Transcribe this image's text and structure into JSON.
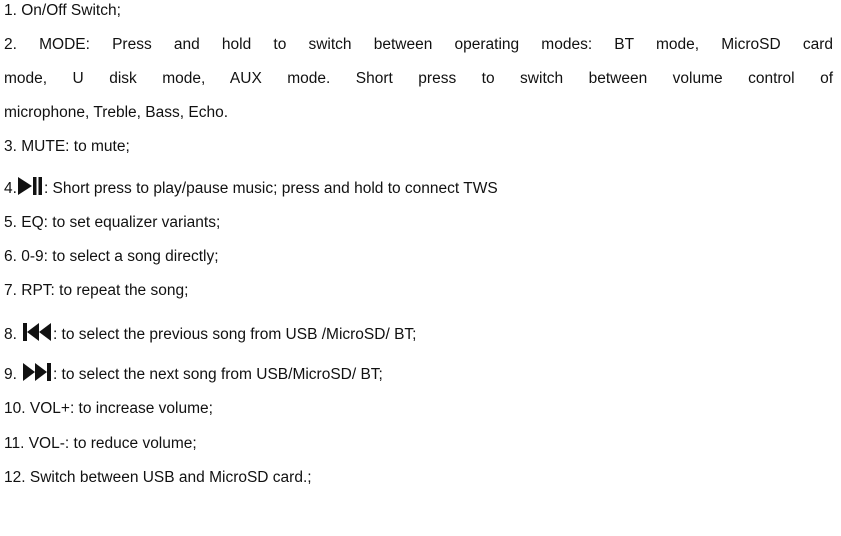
{
  "items": [
    {
      "number": "1.",
      "text": "On/Off Switch;"
    },
    {
      "number": "2.",
      "text": "MODE: Press and hold to switch between operating modes: BT mode, MicroSD card",
      "text_line2": "mode, U disk mode, AUX mode. Short press to switch between volume control of",
      "text_line3": "microphone, Treble, Bass, Echo."
    },
    {
      "number": "3.",
      "text": "MUTE: to mute;"
    },
    {
      "number": "4.",
      "icon": "play-pause-icon",
      "text": ": Short press to play/pause music; press and hold to connect TWS"
    },
    {
      "number": "5.",
      "text": "EQ: to set equalizer variants;"
    },
    {
      "number": "6.",
      "text": "0-9: to select a song directly;"
    },
    {
      "number": "7.",
      "text": "RPT: to repeat the song;"
    },
    {
      "number": "8.",
      "icon": "previous-track-icon",
      "text": ": to select the previous song from USB /MicroSD/ BT;"
    },
    {
      "number": "9.",
      "icon": "next-track-icon",
      "text": ":  to select the next song from USB/MicroSD/ BT;"
    },
    {
      "number": "10.",
      "text": "VOL+: to increase volume;"
    },
    {
      "number": "11.",
      "text": "VOL-: to reduce volume;"
    },
    {
      "number": "12.",
      "text": "Switch between USB and MicroSD card.;"
    }
  ]
}
